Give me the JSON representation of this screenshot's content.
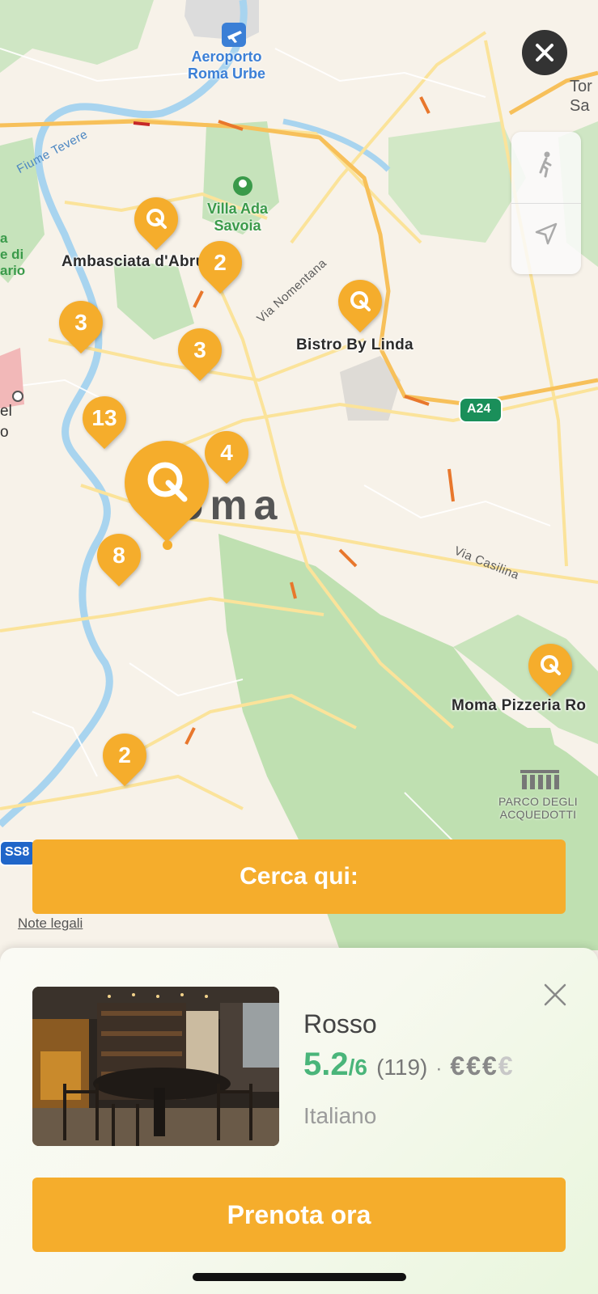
{
  "map": {
    "labels": {
      "airport": "Aeroporto\nRoma Urbe",
      "park_ada": "Villa Ada\nSavoia",
      "river": "Fiume Tevere",
      "ambasciata": "Ambasciata d'Abruzzo",
      "via_nomentana": "Via Nomentana",
      "bistro": "Bistro By Linda",
      "city": "Roma",
      "via_casilina": "Via Casilina",
      "moma": "Moma Pizzeria Ro",
      "parco": "PARCO DEGLI\nACQUEDOTTI",
      "highway_a24": "A24",
      "highway_ss8": "SS8",
      "edge_top_right": "Tor\nSa",
      "edge_left_green": "a\ne di\nario",
      "edge_left_gray": "el\no"
    },
    "pins": [
      {
        "id": "pin-ambasciata",
        "type": "logo",
        "count": ""
      },
      {
        "id": "pin-2-north",
        "type": "count",
        "count": "2"
      },
      {
        "id": "pin-bistro",
        "type": "logo",
        "count": ""
      },
      {
        "id": "pin-3-west",
        "type": "count",
        "count": "3"
      },
      {
        "id": "pin-3-center",
        "type": "count",
        "count": "3"
      },
      {
        "id": "pin-13",
        "type": "count",
        "count": "13"
      },
      {
        "id": "pin-4",
        "type": "count",
        "count": "4"
      },
      {
        "id": "pin-selected",
        "type": "logo",
        "count": ""
      },
      {
        "id": "pin-8",
        "type": "count",
        "count": "8"
      },
      {
        "id": "pin-moma",
        "type": "logo",
        "count": ""
      },
      {
        "id": "pin-2-south",
        "type": "count",
        "count": "2"
      }
    ],
    "search_here_label": "Cerca qui:",
    "legal_label": "Note legali"
  },
  "restaurant": {
    "name": "Rosso",
    "rating": "5.2",
    "rating_max": "/6",
    "review_count": "(119)",
    "separator": "·",
    "price_active": "€€€",
    "price_inactive": "€",
    "cuisine": "Italiano",
    "book_label": "Prenota ora"
  },
  "colors": {
    "accent": "#f5ad2c",
    "rating_green": "#4ab57a"
  }
}
